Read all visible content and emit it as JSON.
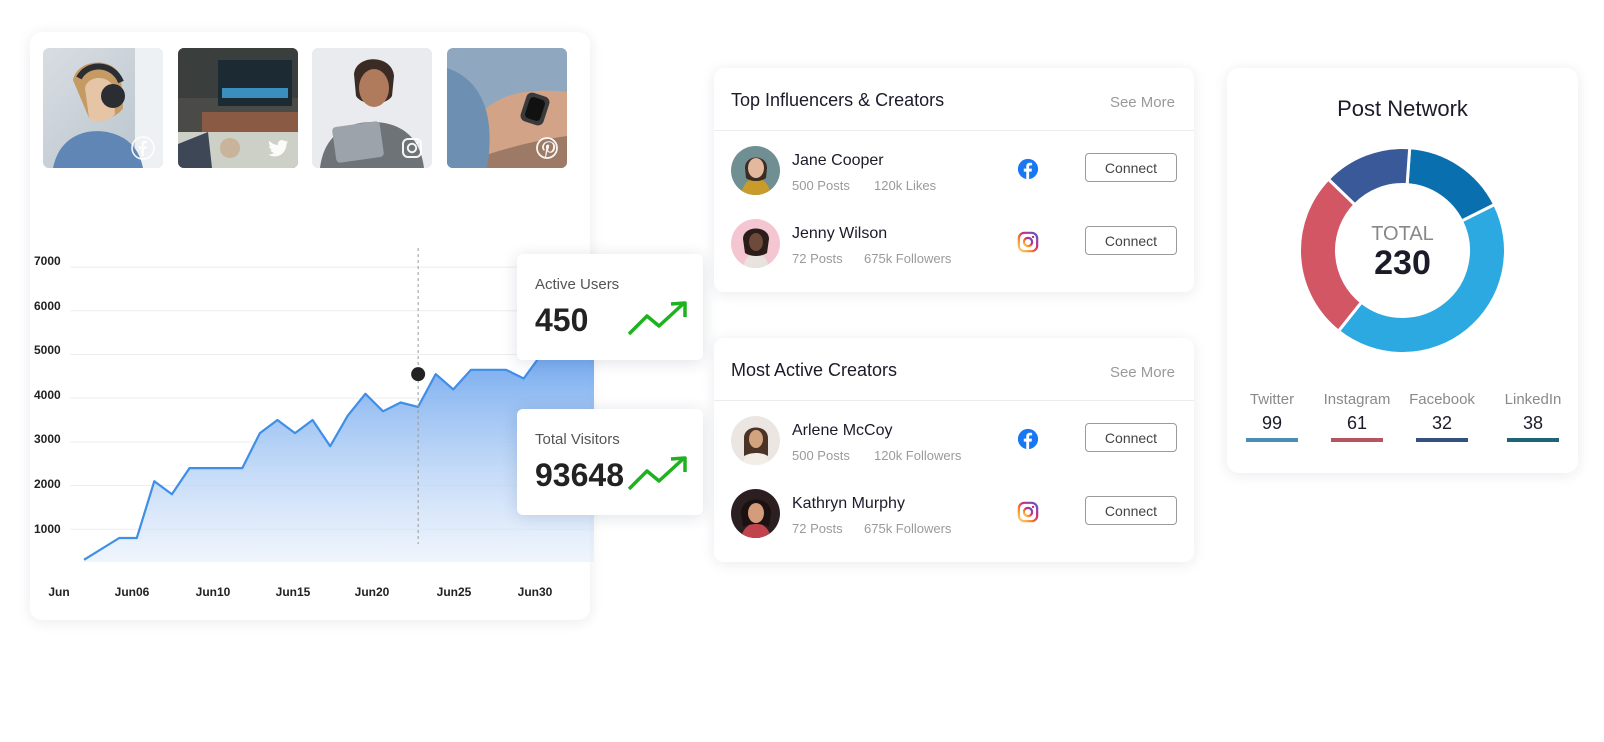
{
  "colors": {
    "accent": "#3f8ee8",
    "trend_green": "#1fb21f",
    "facebook": "#1877f2",
    "instagram": "#d62976"
  },
  "thumbnails": [
    {
      "name": "woman with headphones",
      "network_icon": "facebook-icon"
    },
    {
      "name": "smart tv living room",
      "network_icon": "twitter-icon"
    },
    {
      "name": "woman with tablet",
      "network_icon": "instagram-icon"
    },
    {
      "name": "smartwatch on wrist",
      "network_icon": "pinterest-icon"
    }
  ],
  "chart_data": {
    "type": "area",
    "x_ticks": [
      "Jun",
      "Jun06",
      "Jun10",
      "Jun15",
      "Jun20",
      "Jun25",
      "Jun30"
    ],
    "y_ticks": [
      "7000",
      "6000",
      "5000",
      "4000",
      "3000",
      "2000",
      "1000"
    ],
    "ylim": [
      250,
      7300
    ],
    "x": [
      1,
      3,
      4,
      5,
      6,
      7,
      8,
      9,
      10,
      11,
      12,
      13,
      14,
      15,
      16,
      17,
      18,
      19,
      20,
      21,
      22,
      23,
      24,
      25,
      26,
      27,
      28,
      29,
      30
    ],
    "values": [
      300,
      800,
      800,
      2100,
      1800,
      2400,
      2400,
      2400,
      2400,
      3200,
      3500,
      3200,
      3500,
      2900,
      3600,
      4100,
      3700,
      3900,
      3800,
      4550,
      4200,
      4650,
      4650,
      4650,
      4450,
      5000,
      5000,
      5000,
      5000
    ],
    "highlight": {
      "x": 20,
      "y": 4550
    }
  },
  "stats": {
    "active_users": {
      "label": "Active Users",
      "value": "450"
    },
    "total_visitors": {
      "label": "Total Visitors",
      "value": "93648"
    }
  },
  "top_influencers": {
    "title": "Top Influencers & Creators",
    "see_more": "See More",
    "rows": [
      {
        "name": "Jane Cooper",
        "posts": "500 Posts",
        "metric": "120k Likes",
        "network": "facebook-icon",
        "action": "Connect"
      },
      {
        "name": "Jenny Wilson",
        "posts": "72 Posts",
        "metric": "675k Followers",
        "network": "instagram-icon",
        "action": "Connect"
      }
    ]
  },
  "most_active": {
    "title": "Most Active Creators",
    "see_more": "See More",
    "rows": [
      {
        "name": "Arlene McCoy",
        "posts": "500 Posts",
        "metric": "120k Followers",
        "network": "facebook-icon",
        "action": "Connect"
      },
      {
        "name": "Kathryn Murphy",
        "posts": "72 Posts",
        "metric": "675k Followers",
        "network": "instagram-icon",
        "action": "Connect"
      }
    ]
  },
  "post_network": {
    "title": "Post Network",
    "total_label": "TOTAL",
    "total_value": "230",
    "segments": [
      {
        "name": "Twitter",
        "value": 99,
        "display": "99",
        "color": "#2ba9e0"
      },
      {
        "name": "Instagram",
        "value": 61,
        "display": "61",
        "color": "#d25663"
      },
      {
        "name": "Facebook",
        "value": 32,
        "display": "32",
        "color": "#3a5999"
      },
      {
        "name": "LinkedIn",
        "value": 38,
        "display": "38",
        "color": "#0a6fae"
      }
    ],
    "legend_bar_colors": [
      "#4a8db5",
      "#b45560",
      "#34507f",
      "#1e6477"
    ]
  }
}
